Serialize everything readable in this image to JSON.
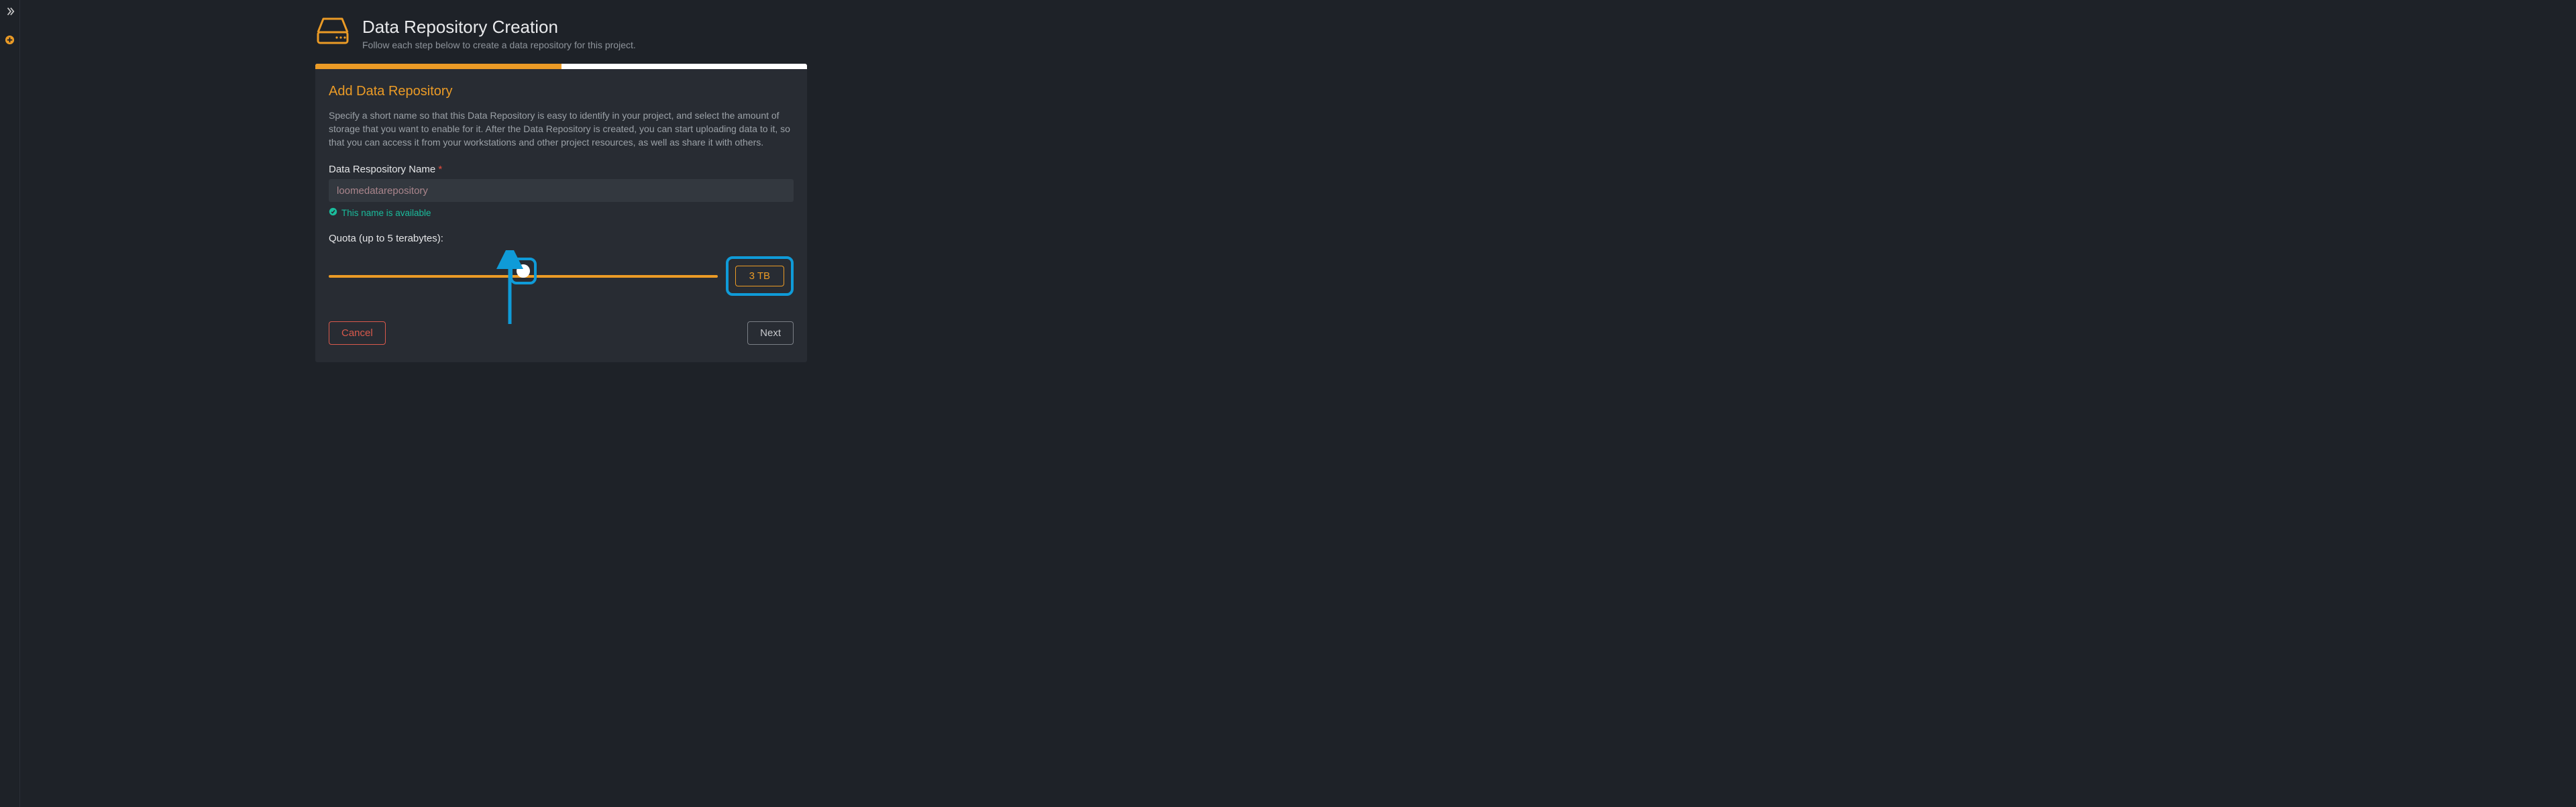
{
  "header": {
    "title": "Data Repository Creation",
    "subtitle": "Follow each step below to create a data repository for this project."
  },
  "progress": {
    "percent": 50
  },
  "step": {
    "title": "Add Data Repository",
    "description": "Specify a short name so that this Data Repository is easy to identify in your project, and select the amount of storage that you want to enable for it. After the Data Repository is created, you can start uploading data to it, so that you can access it from your workstations and other project resources, as well as share it with others."
  },
  "name_field": {
    "label": "Data Respository Name",
    "required_mark": "*",
    "value": "loomedatarepository",
    "availability_text": "This name is available"
  },
  "quota": {
    "label": "Quota (up to 5 terabytes):",
    "value_percent": 50,
    "display": "3 TB"
  },
  "buttons": {
    "cancel": "Cancel",
    "next": "Next"
  },
  "colors": {
    "accent": "#eb9b26",
    "annotation": "#0f9bd8",
    "success": "#1abc9c",
    "danger": "#d9594c"
  }
}
